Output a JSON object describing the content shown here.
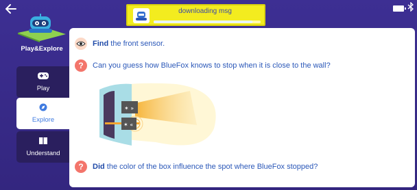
{
  "app": {
    "title": "Play&Explore"
  },
  "status": {
    "message": "downloading msg",
    "progress": 0.92
  },
  "icons": {
    "back": "arrow-left-icon",
    "battery": "battery-icon",
    "bluetooth": "bluetooth-icon",
    "robot": "robot-icon",
    "eye": "eye-icon",
    "question": "question-icon",
    "gamepad": "gamepad-icon",
    "compass": "compass-icon",
    "book": "book-icon"
  },
  "sidebar": {
    "items": [
      {
        "label": "Play",
        "active": false
      },
      {
        "label": "Explore",
        "active": true
      },
      {
        "label": "Understand",
        "active": false
      }
    ]
  },
  "content": {
    "find": {
      "bold": "Find",
      "rest": " the front sensor."
    },
    "question1": "Can you guess how BlueFox knows to stop when it is close to the wall?",
    "question2": {
      "bold": "Did",
      "rest": " the color of the box influence the spot where BlueFox stopped?"
    }
  },
  "colors": {
    "background": "#3b2d8c",
    "status_bar": "#f3ec1f",
    "accent_blue": "#2a57b8",
    "question_red": "#f3756b",
    "nav_inactive": "#2a1f5e"
  }
}
